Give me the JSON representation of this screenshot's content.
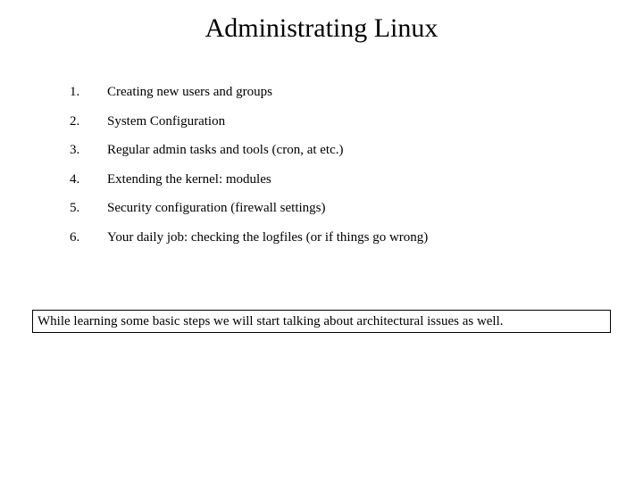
{
  "slide": {
    "title": "Administrating Linux",
    "background_color": "#ffffff",
    "text_color": "#000000",
    "agenda": [
      {
        "number": "1.",
        "text": "Creating new users and groups"
      },
      {
        "number": "2.",
        "text": "System Configuration"
      },
      {
        "number": "3.",
        "text": "Regular admin tasks and tools (cron, at etc.)"
      },
      {
        "number": "4.",
        "text": "Extending the kernel: modules"
      },
      {
        "number": "5.",
        "text": "Security configuration (firewall settings)"
      },
      {
        "number": "6.",
        "text": "Your daily job: checking the logfiles (or if things go wrong)"
      }
    ],
    "callout": {
      "text": "While learning some basic steps we will start talking about architectural issues as well.",
      "border_color": "#000000"
    }
  }
}
